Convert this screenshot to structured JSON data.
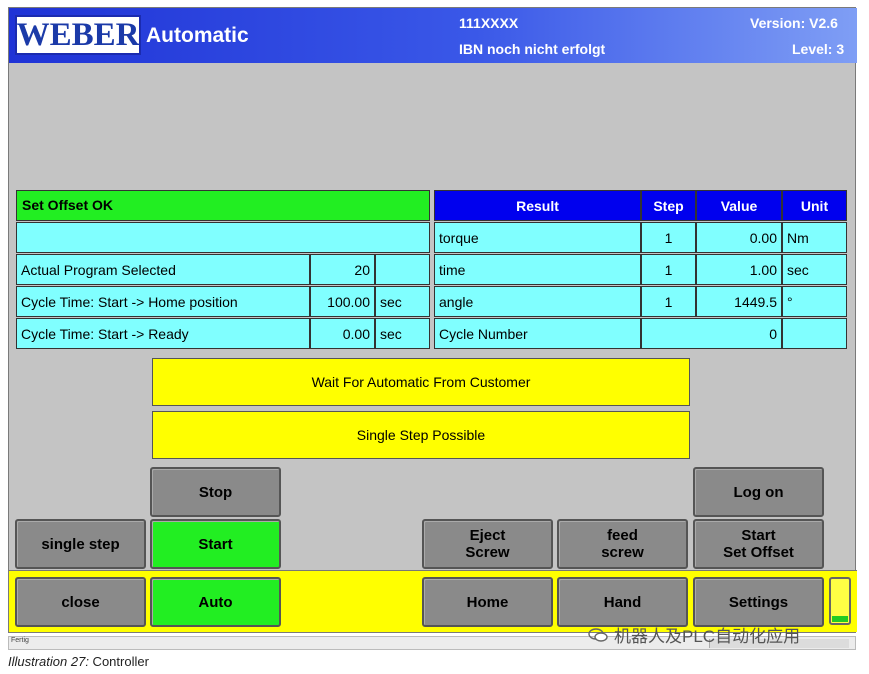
{
  "header": {
    "logo_text": "WEBER",
    "app_title": "Automatic",
    "program_id": "111XXXX",
    "ibn_status": "IBN noch nicht erfolgt",
    "version": "Version: V2.6",
    "level": "Level: 3"
  },
  "status_message": "Set Offset OK",
  "program_table": {
    "rows": [
      {
        "label": "Actual Program Selected",
        "value": "20",
        "unit": ""
      },
      {
        "label": "Cycle Time: Start -> Home position",
        "value": "100.00",
        "unit": "sec"
      },
      {
        "label": "Cycle Time: Start -> Ready",
        "value": "0.00",
        "unit": "sec"
      }
    ]
  },
  "result_table": {
    "headers": {
      "result": "Result",
      "step": "Step",
      "value": "Value",
      "unit": "Unit"
    },
    "rows": [
      {
        "result": "torque",
        "step": "1",
        "value": "0.00",
        "unit": "Nm"
      },
      {
        "result": "time",
        "step": "1",
        "value": "1.00",
        "unit": "sec"
      },
      {
        "result": "angle",
        "step": "1",
        "value": "1449.5",
        "unit": "°"
      }
    ],
    "cycle_number_label": "Cycle Number",
    "cycle_number_value": "0"
  },
  "messages": {
    "wait": "Wait For Automatic From Customer",
    "single_step": "Single Step Possible"
  },
  "buttons": {
    "stop": "Stop",
    "log_on": "Log on",
    "single_step": "single step",
    "start": "Start",
    "eject_screw": "Eject\nScrew",
    "feed_screw": "feed\nscrew",
    "start_set_offset": "Start\nSet Offset",
    "close": "close",
    "auto": "Auto",
    "home": "Home",
    "hand": "Hand",
    "settings": "Settings"
  },
  "statusbar": {
    "left": "Fertig"
  },
  "watermark": "机器人及PLC自动化应用",
  "caption": {
    "label": "Illustration 27:",
    "text": " Controller"
  },
  "colors": {
    "title_blue": "#1f33d6",
    "table_header_blue": "#0000ee",
    "cyan": "#80ffff",
    "green": "#22ee22",
    "yellow": "#ffff00",
    "gray_button": "#8a8a8a"
  }
}
